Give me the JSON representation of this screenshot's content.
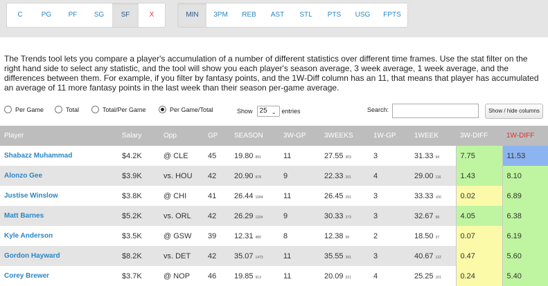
{
  "positions": [
    {
      "label": "C",
      "active": false
    },
    {
      "label": "PG",
      "active": false
    },
    {
      "label": "PF",
      "active": false
    },
    {
      "label": "SG",
      "active": false
    },
    {
      "label": "SF",
      "active": true
    },
    {
      "label": "X",
      "active": false
    }
  ],
  "stats": [
    {
      "label": "MIN",
      "active": true
    },
    {
      "label": "3PM",
      "active": false
    },
    {
      "label": "REB",
      "active": false
    },
    {
      "label": "AST",
      "active": false
    },
    {
      "label": "STL",
      "active": false
    },
    {
      "label": "PTS",
      "active": false
    },
    {
      "label": "USG",
      "active": false
    },
    {
      "label": "FPTS",
      "active": false
    }
  ],
  "description": "The Trends tool lets you compare a player's accumulation of a number of different statistics over different time frames. Use the stat filter on the right hand side to select any statistic, and the tool will show you each player's season average, 3 week average, 1 week average, and the differences between them. For example, if you filter by fantasy points, and the 1W-Diff column has an 11, that means that player has accumulated an average of 11 more fantasy points in the last week than their season per-game average.",
  "view_options": [
    {
      "label": "Per Game",
      "checked": false
    },
    {
      "label": "Total",
      "checked": false
    },
    {
      "label": "Total/Per Game",
      "checked": false
    },
    {
      "label": "Per Game/Total",
      "checked": true
    }
  ],
  "entries": {
    "show_label": "Show",
    "value": "25",
    "suffix": "entries"
  },
  "search": {
    "label": "Search:",
    "value": ""
  },
  "show_hide_label": "Show / hide columns",
  "columns": [
    "Player",
    "Salary",
    "Opp",
    "GP",
    "SEASON",
    "3W-GP",
    "3WEEKS",
    "1W-GP",
    "1WEEK",
    "3W-DIFF",
    "1W-DIFF"
  ],
  "rows": [
    {
      "player": "Shabazz Muhammad",
      "salary": "$4.2K",
      "opp": "@ CLE",
      "gp": "45",
      "season": "19.80",
      "season_total": "891",
      "gp3w": "11",
      "weeks3": "27.55",
      "weeks3_total": "303",
      "gp1w": "3",
      "week1": "31.33",
      "week1_total": "94",
      "diff3w": "7.75",
      "diff3w_color": "green",
      "diff1w": "11.53",
      "diff1w_color": "blue"
    },
    {
      "player": "Alonzo Gee",
      "salary": "$3.9K",
      "opp": "vs. HOU",
      "gp": "42",
      "season": "20.90",
      "season_total": "878",
      "gp3w": "9",
      "weeks3": "22.33",
      "weeks3_total": "201",
      "gp1w": "4",
      "week1": "29.00",
      "week1_total": "116",
      "diff3w": "1.43",
      "diff3w_color": "green",
      "diff1w": "8.10",
      "diff1w_color": "green"
    },
    {
      "player": "Justise Winslow",
      "salary": "$3.8K",
      "opp": "@ CHI",
      "gp": "41",
      "season": "26.44",
      "season_total": "1084",
      "gp3w": "11",
      "weeks3": "26.45",
      "weeks3_total": "291",
      "gp1w": "3",
      "week1": "33.33",
      "week1_total": "100",
      "diff3w": "0.02",
      "diff3w_color": "yellow",
      "diff1w": "6.89",
      "diff1w_color": "green"
    },
    {
      "player": "Matt Barnes",
      "salary": "$5.2K",
      "opp": "vs. ORL",
      "gp": "42",
      "season": "26.29",
      "season_total": "1104",
      "gp3w": "9",
      "weeks3": "30.33",
      "weeks3_total": "273",
      "gp1w": "3",
      "week1": "32.67",
      "week1_total": "98",
      "diff3w": "4.05",
      "diff3w_color": "green",
      "diff1w": "6.38",
      "diff1w_color": "green"
    },
    {
      "player": "Kyle Anderson",
      "salary": "$3.5K",
      "opp": "@ GSW",
      "gp": "39",
      "season": "12.31",
      "season_total": "480",
      "gp3w": "8",
      "weeks3": "12.38",
      "weeks3_total": "99",
      "gp1w": "2",
      "week1": "18.50",
      "week1_total": "37",
      "diff3w": "0.07",
      "diff3w_color": "yellow",
      "diff1w": "6.19",
      "diff1w_color": "green"
    },
    {
      "player": "Gordon Hayward",
      "salary": "$8.2K",
      "opp": "vs. DET",
      "gp": "42",
      "season": "35.07",
      "season_total": "1473",
      "gp3w": "11",
      "weeks3": "35.55",
      "weeks3_total": "391",
      "gp1w": "3",
      "week1": "40.67",
      "week1_total": "122",
      "diff3w": "0.47",
      "diff3w_color": "yellow",
      "diff1w": "5.60",
      "diff1w_color": "green"
    },
    {
      "player": "Corey Brewer",
      "salary": "$3.7K",
      "opp": "@ NOP",
      "gp": "46",
      "season": "19.85",
      "season_total": "913",
      "gp3w": "11",
      "weeks3": "20.09",
      "weeks3_total": "221",
      "gp1w": "4",
      "week1": "25.25",
      "week1_total": "101",
      "diff3w": "0.24",
      "diff3w_color": "yellow",
      "diff1w": "5.40",
      "diff1w_color": "green"
    }
  ]
}
